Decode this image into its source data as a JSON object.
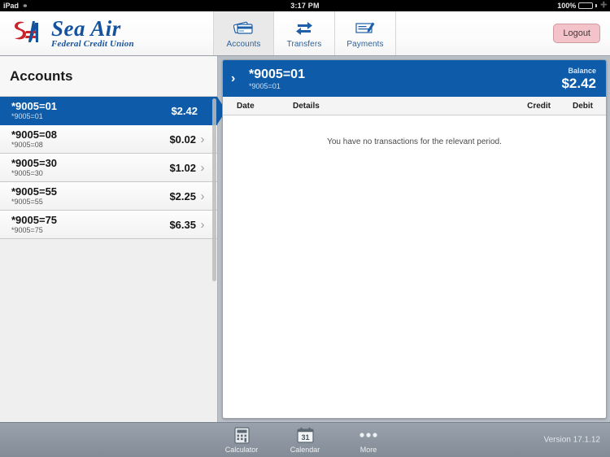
{
  "statusbar": {
    "device": "iPad",
    "wifi_icon": "wifi-icon",
    "time": "3:17 PM",
    "battery_percent": "100%",
    "battery_icon": "battery-full-icon",
    "charging_icon": "charging-bolt-icon"
  },
  "header": {
    "logo_mark": "sea-air-monogram-icon",
    "brand_name": "Sea Air",
    "brand_subtitle": "Federal Credit Union",
    "tabs": [
      {
        "label": "Accounts",
        "icon": "credit-cards-icon",
        "selected": true
      },
      {
        "label": "Transfers",
        "icon": "transfer-arrows-icon",
        "selected": false
      },
      {
        "label": "Payments",
        "icon": "check-pen-icon",
        "selected": false
      }
    ],
    "logout_label": "Logout"
  },
  "sidebar": {
    "title": "Accounts",
    "accounts": [
      {
        "name": "*9005=01",
        "sub": "*9005=01",
        "balance": "$2.42",
        "selected": true
      },
      {
        "name": "*9005=08",
        "sub": "*9005=08",
        "balance": "$0.02",
        "selected": false
      },
      {
        "name": "*9005=30",
        "sub": "*9005=30",
        "balance": "$1.02",
        "selected": false
      },
      {
        "name": "*9005=55",
        "sub": "*9005=55",
        "balance": "$2.25",
        "selected": false
      },
      {
        "name": "*9005=75",
        "sub": "*9005=75",
        "balance": "$6.35",
        "selected": false
      }
    ],
    "chevron_icon": "chevron-right-icon"
  },
  "main": {
    "banner": {
      "chevron_icon": "chevron-right-icon",
      "account_name": "*9005=01",
      "account_sub": "*9005=01",
      "balance_label": "Balance",
      "balance_value": "$2.42"
    },
    "columns": {
      "date": "Date",
      "details": "Details",
      "credit": "Credit",
      "debit": "Debit"
    },
    "empty_message": "You have no transactions for the relevant period."
  },
  "toolbar": {
    "items": [
      {
        "label": "Calculator",
        "icon": "calculator-icon"
      },
      {
        "label": "Calendar",
        "icon": "calendar-icon",
        "day": "31"
      },
      {
        "label": "More",
        "icon": "ellipsis-icon"
      }
    ],
    "version": "Version 17.1.12"
  },
  "colors": {
    "brand_blue": "#0d5ba9",
    "logo_blue": "#15529e",
    "logo_red": "#c8242c",
    "logout_bg": "#f3c3c9",
    "toolbar_gray": "#8d96a1"
  }
}
